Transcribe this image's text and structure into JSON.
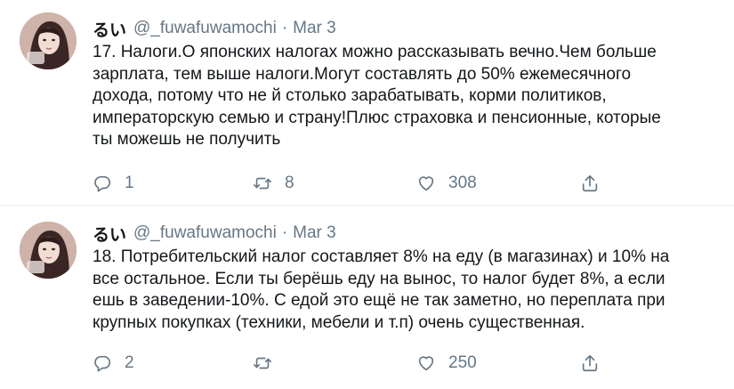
{
  "tweets": [
    {
      "display_name": "るい",
      "handle": "@_fuwafuwamochi",
      "separator": "·",
      "date": "Mar 3",
      "text": "17. Налоги.О японских налогах можно рассказывать вечно.Чем больше\nзарплата, тем выше налоги.Могут составлять до 50% ежемесячного\nдохода, потому что не   й столько зарабатывать, корми политиков,\nимператорскую семью и страну!Плюс страховка и пенсионные, которые\nты можешь не получить",
      "replies": "1",
      "retweets": "8",
      "likes": "308"
    },
    {
      "display_name": "るい",
      "handle": "@_fuwafuwamochi",
      "separator": "·",
      "date": "Mar 3",
      "text": "18. Потребительский налог составляет 8% на еду (в магазинах) и 10% на\nвсе остальное. Если ты берёшь еду на вынос, то налог будет 8%, а если\nешь в заведении-10%. С едой это ещё не так заметно, но переплата при\nкрупных покупках (техники, мебели и т.п) очень существенная.",
      "replies": "2",
      "retweets": "",
      "likes": "250"
    }
  ],
  "icons": {
    "reply": "reply-icon",
    "retweet": "retweet-icon",
    "like": "heart-icon",
    "share": "share-icon"
  },
  "colors": {
    "text": "#14171a",
    "secondary": "#657786",
    "divider": "#e6ecf0"
  }
}
